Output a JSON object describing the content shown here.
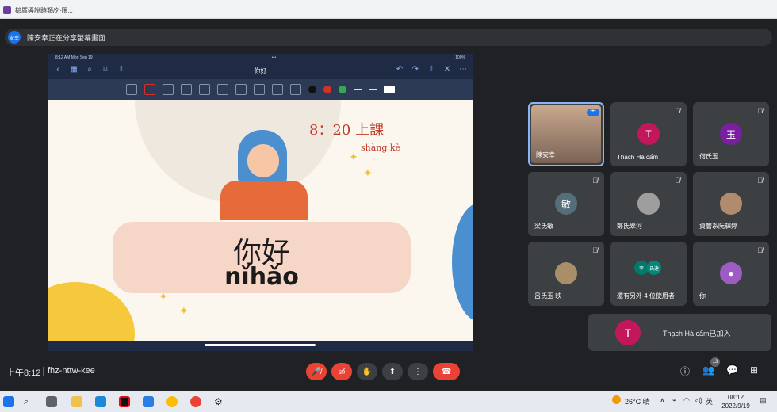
{
  "browser_tab": {
    "title": "槌厲導說蹺類/外匯..."
  },
  "share_banner": {
    "avatar_text": "安幸",
    "text": "陳安幸正在分享螢幕畫面"
  },
  "ipad": {
    "status_left": "8:12 AM   Mon Sep 19",
    "status_center": "•••",
    "status_right": "100%",
    "nav_title": "你好",
    "colors": {
      "black": "#111111",
      "red": "#d93025",
      "green": "#34a853"
    }
  },
  "slide": {
    "time_note": "8：20 上課",
    "time_pinyin": "shàng kè",
    "hanzi": "你好",
    "pinyin": "nǐhǎo"
  },
  "participants": [
    {
      "name": "陳安幸",
      "type": "video"
    },
    {
      "name": "Thạch Hà cẩm",
      "initial": "T",
      "color": "#c2185b"
    },
    {
      "name": "何氏玉",
      "initial": "玉",
      "color": "#7b1fa2"
    },
    {
      "name": "梁氏敏",
      "initial": "敏",
      "color": "#546e7a"
    },
    {
      "name": "鄭氏翠河",
      "type": "photo"
    },
    {
      "name": "資管系阮驛婷",
      "type": "photo"
    },
    {
      "name": "呂氏玉 映",
      "type": "photo"
    },
    {
      "name": "還有另外 4 位使用者",
      "mini_a": "李",
      "mini_b": "氏達"
    },
    {
      "name": "你",
      "type": "self"
    }
  ],
  "notification": {
    "initial": "T",
    "text": "Thạch Hà cẩm已加入"
  },
  "meet_bar": {
    "time": "上午8:12",
    "code": "fhz-nttw-kee",
    "people_count": "13"
  },
  "taskbar": {
    "weather": "26°C 晴",
    "lang": "英",
    "time": "08:12",
    "date": "2022/9/19"
  }
}
